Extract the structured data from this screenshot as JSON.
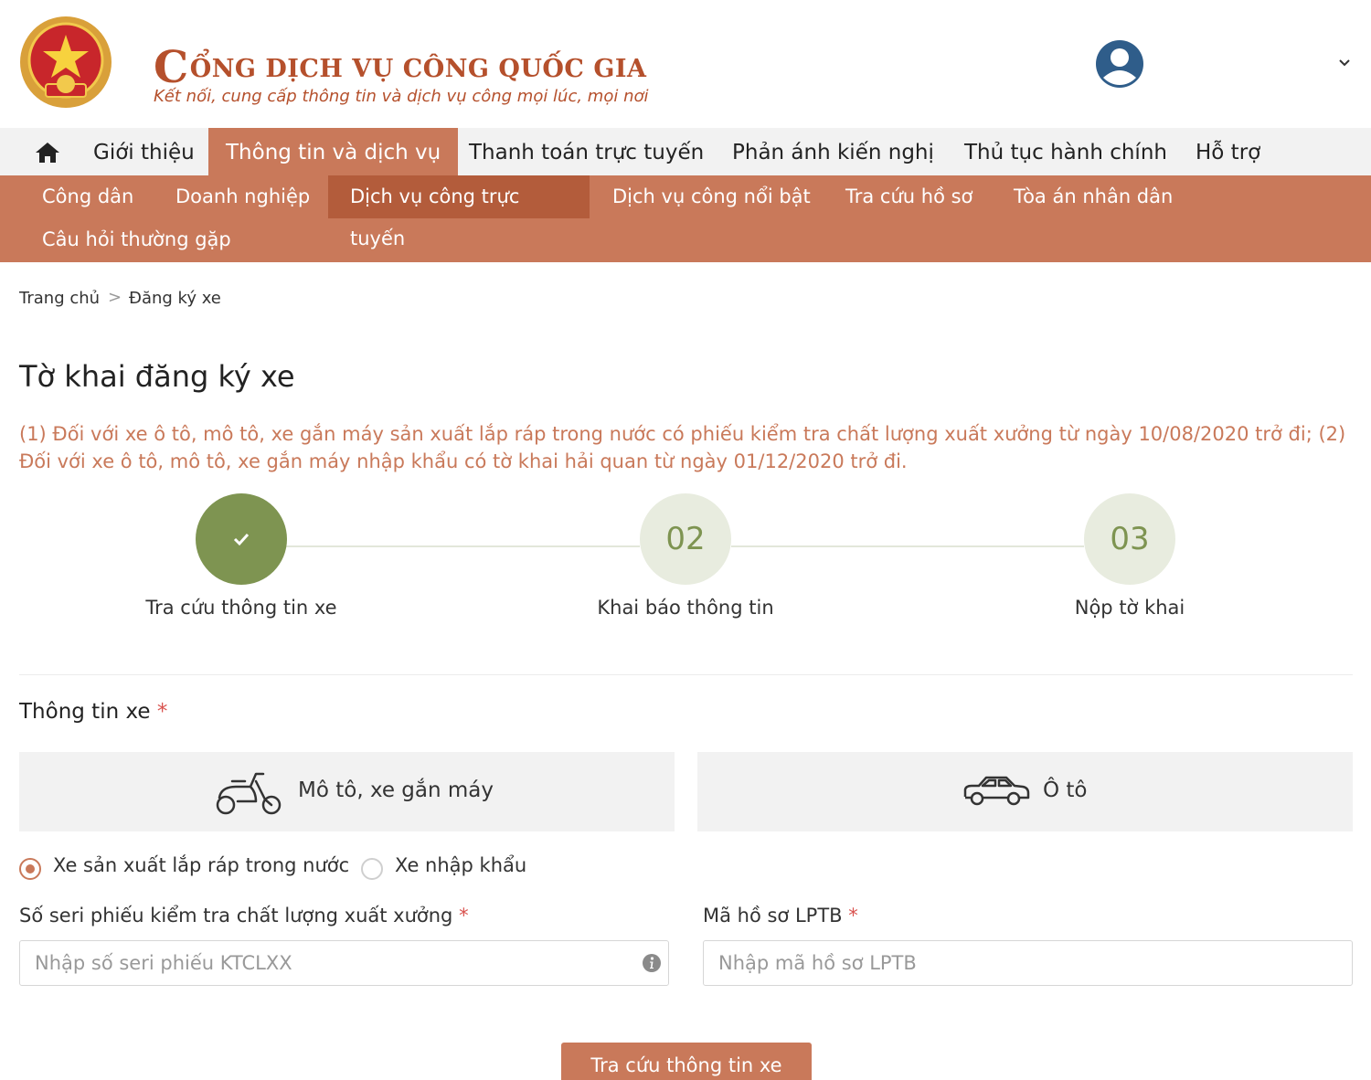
{
  "header": {
    "title_initial": "C",
    "title_rest": "ỔNG DỊCH VỤ CÔNG QUỐC GIA",
    "subtitle": "Kết nối, cung cấp thông tin và dịch vụ công mọi lúc, mọi nơi",
    "icons": {
      "emblem": "national-emblem-icon",
      "avatar": "user-avatar-icon",
      "chevron": "chevron-down-icon"
    }
  },
  "main_nav": {
    "home_icon": "home-icon",
    "items": [
      {
        "label": "Giới thiệu"
      },
      {
        "label": "Thông tin và dịch vụ",
        "active": true
      },
      {
        "label": "Thanh toán trực tuyến"
      },
      {
        "label": "Phản ánh kiến nghị"
      },
      {
        "label": "Thủ tục hành chính"
      },
      {
        "label": "Hỗ trợ"
      }
    ]
  },
  "sub_nav": {
    "items": [
      {
        "label": "Công dân"
      },
      {
        "label": "Doanh nghiệp"
      },
      {
        "label": "Dịch vụ công trực tuyến",
        "active": true
      },
      {
        "label": "Dịch vụ công nổi bật"
      },
      {
        "label": "Tra cứu hồ sơ"
      },
      {
        "label": "Tòa án nhân dân"
      },
      {
        "label": "Câu hỏi thường gặp"
      }
    ]
  },
  "breadcrumb": {
    "home": "Trang chủ",
    "separator": ">",
    "current": "Đăng ký xe"
  },
  "page": {
    "title": "Tờ khai đăng ký xe",
    "notice": "(1) Đối với xe ô tô, mô tô, xe gắn máy sản xuất lắp ráp trong nước có phiếu kiểm tra chất lượng xuất xưởng từ ngày 10/08/2020 trở đi; (2) Đối với xe ô tô, mô tô, xe gắn máy nhập khẩu có tờ khai hải quan từ ngày 01/12/2020 trở đi."
  },
  "stepper": {
    "steps": [
      {
        "number": "",
        "label": "Tra cứu thông tin xe",
        "status": "done",
        "icon": "check-icon"
      },
      {
        "number": "02",
        "label": "Khai báo thông tin",
        "status": "pending"
      },
      {
        "number": "03",
        "label": "Nộp tờ khai",
        "status": "pending"
      }
    ]
  },
  "vehicle_section": {
    "title": "Thông tin xe",
    "required_mark": "*",
    "types": [
      {
        "label": "Mô tô, xe gắn máy",
        "icon": "motorbike-icon"
      },
      {
        "label": "Ô tô",
        "icon": "car-icon"
      }
    ],
    "origin_options": [
      {
        "label": "Xe sản xuất lắp ráp trong nước",
        "checked": true
      },
      {
        "label": "Xe nhập khẩu",
        "checked": false
      }
    ]
  },
  "fields": {
    "serial": {
      "label": "Số seri phiếu kiểm tra chất lượng xuất xưởng",
      "required_mark": "*",
      "placeholder": "Nhập số seri phiếu KTCLXX",
      "value": "",
      "icon": "info-icon"
    },
    "lptb": {
      "label": "Mã hồ sơ LPTB",
      "required_mark": "*",
      "placeholder": "Nhập mã hồ sơ LPTB",
      "value": ""
    }
  },
  "submit": {
    "label": "Tra cứu thông tin xe"
  },
  "colors": {
    "brand": "#c9795a",
    "brand_dark": "#b35c3b",
    "title_red": "#b5502c",
    "step_green": "#7e9451",
    "step_pale": "#e8ecdf",
    "required": "#d9534f"
  }
}
